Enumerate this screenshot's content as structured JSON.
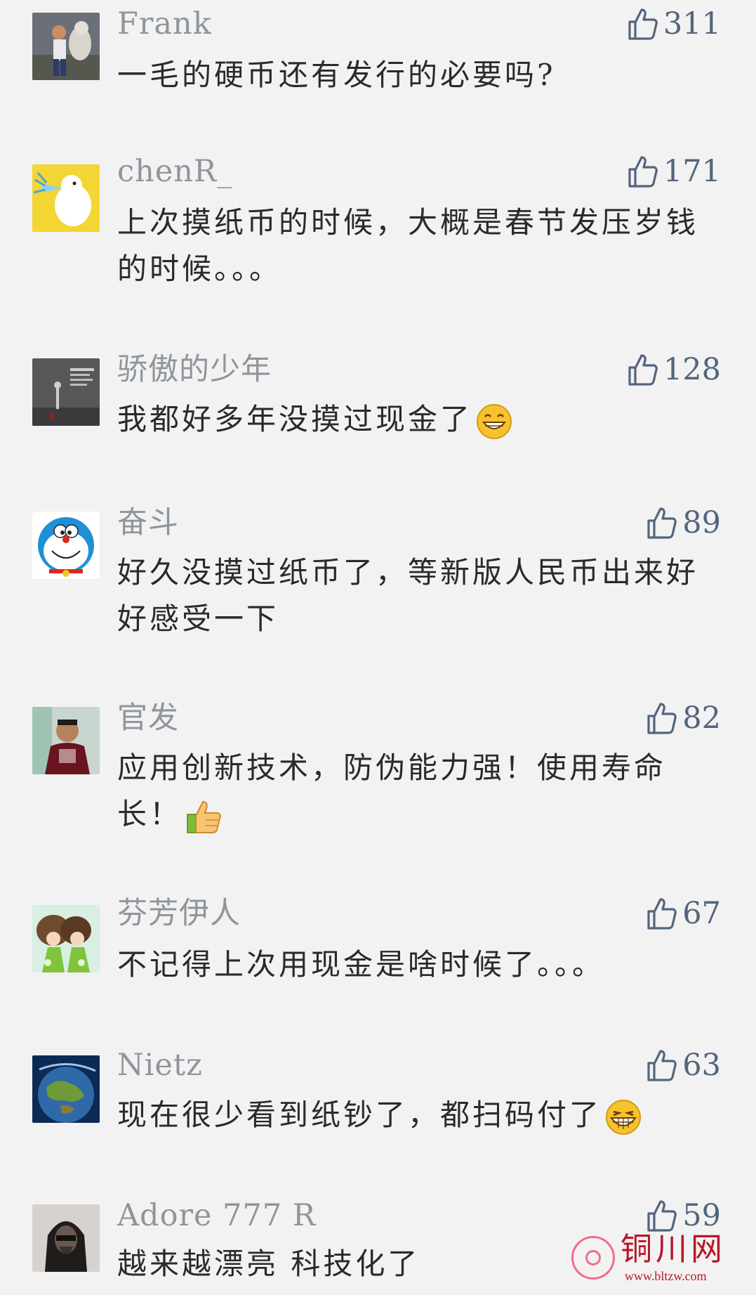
{
  "comments": [
    {
      "username": "Frank",
      "likes": "311",
      "text": "一毛的硬币还有发行的必要吗?",
      "emoji": null
    },
    {
      "username": "chenR_",
      "likes": "171",
      "text": "上次摸纸币的时候，大概是春节发压岁钱的时候。。。",
      "emoji": null
    },
    {
      "username": "骄傲的少年",
      "likes": "128",
      "text": "我都好多年没摸过现金了",
      "emoji": "grin-emoji"
    },
    {
      "username": "奋斗",
      "likes": "89",
      "text": "好久没摸过纸币了，等新版人民币出来好好感受一下",
      "emoji": null
    },
    {
      "username": "官发",
      "likes": "82",
      "text": "应用创新技术，防伪能力强！使用寿命长！",
      "emoji": "thumbs-up-emoji"
    },
    {
      "username": "芬芳伊人",
      "likes": "67",
      "text": "不记得上次用现金是啥时候了。。。",
      "emoji": null
    },
    {
      "username": "Nietz",
      "likes": "63",
      "text": "现在很少看到纸钞了，都扫码付了",
      "emoji": "laugh-emoji"
    },
    {
      "username": "Adore 777 R",
      "likes": "59",
      "text": "越来越漂亮 科技化了",
      "emoji": null
    }
  ],
  "watermark": {
    "title": "铜川网",
    "url": "www.bltzw.com"
  },
  "colors": {
    "background": "#f2f2f2",
    "username": "#8f959c",
    "like_count": "#53657d",
    "comment_text": "#2a2a2a",
    "watermark": "#b9152a"
  },
  "icons": {
    "like": "thumbs-up-outline-icon"
  }
}
